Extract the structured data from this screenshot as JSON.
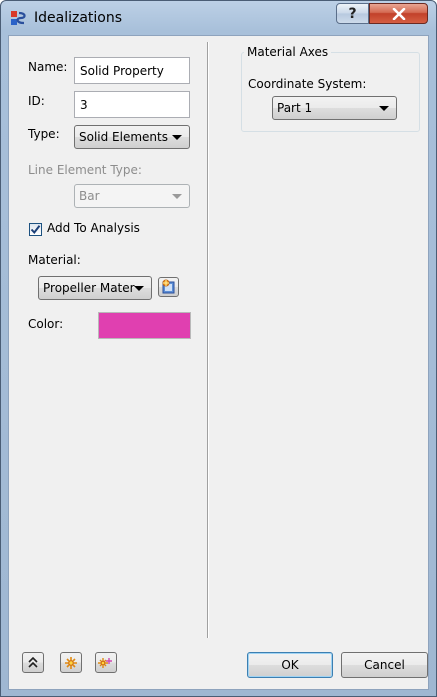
{
  "window": {
    "title": "Idealizations",
    "help_glyph": "?",
    "icon": "idealizations-app-icon"
  },
  "form": {
    "name_label": "Name:",
    "name_value": "Solid Property",
    "id_label": "ID:",
    "id_value": "3",
    "type_label": "Type:",
    "type_value": "Solid Elements",
    "line_element_label": "Line Element Type:",
    "line_element_value": "Bar",
    "add_to_analysis_label": "Add To Analysis",
    "add_to_analysis_checked": true,
    "material_label": "Material:",
    "material_value": "Propeller Mater",
    "color_label": "Color:",
    "color_value": "#e040b0"
  },
  "material_axes": {
    "group_title": "Material Axes",
    "coord_label": "Coordinate System:",
    "coord_value": "Part 1"
  },
  "footer": {
    "ok_label": "OK",
    "cancel_label": "Cancel"
  }
}
